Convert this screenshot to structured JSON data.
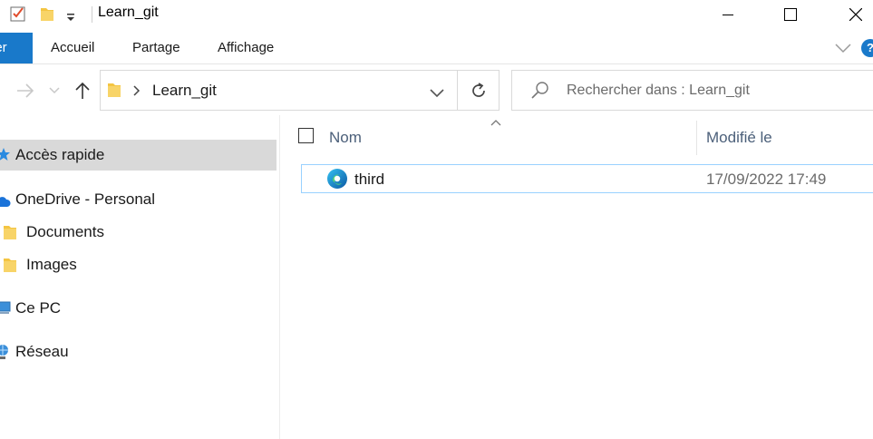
{
  "window": {
    "title": "Learn_git",
    "controls": [
      "minimize",
      "maximize",
      "close"
    ]
  },
  "quick_access_toolbar": {
    "icons": [
      "properties-icon",
      "new-folder-icon",
      "customize-dropdown-icon"
    ]
  },
  "ribbon": {
    "tabs": [
      {
        "label": "ier",
        "active": true
      },
      {
        "label": "Accueil"
      },
      {
        "label": "Partage"
      },
      {
        "label": "Affichage"
      }
    ],
    "help": "?"
  },
  "address_bar": {
    "path": [
      "Learn_git"
    ]
  },
  "search": {
    "placeholder": "Rechercher dans : Learn_git"
  },
  "nav_pane": {
    "items": [
      {
        "label": "Accès rapide",
        "icon": "star-icon",
        "selected": true
      },
      {
        "label": "OneDrive - Personal",
        "icon": "cloud-icon"
      },
      {
        "label": "Documents",
        "icon": "folder-icon"
      },
      {
        "label": "Images",
        "icon": "folder-icon"
      },
      {
        "label": "Ce PC",
        "icon": "computer-icon"
      },
      {
        "label": "Réseau",
        "icon": "network-icon"
      }
    ]
  },
  "file_list": {
    "columns": {
      "name": "Nom",
      "modified": "Modifié le"
    },
    "rows": [
      {
        "name": "third",
        "modified": "17/09/2022 17:49",
        "icon": "edge-icon"
      }
    ]
  },
  "colors": {
    "accent": "#1979ca",
    "selection_border": "#99d1ff",
    "nav_selected": "#d9d9d9",
    "folder": "#f4c542"
  }
}
